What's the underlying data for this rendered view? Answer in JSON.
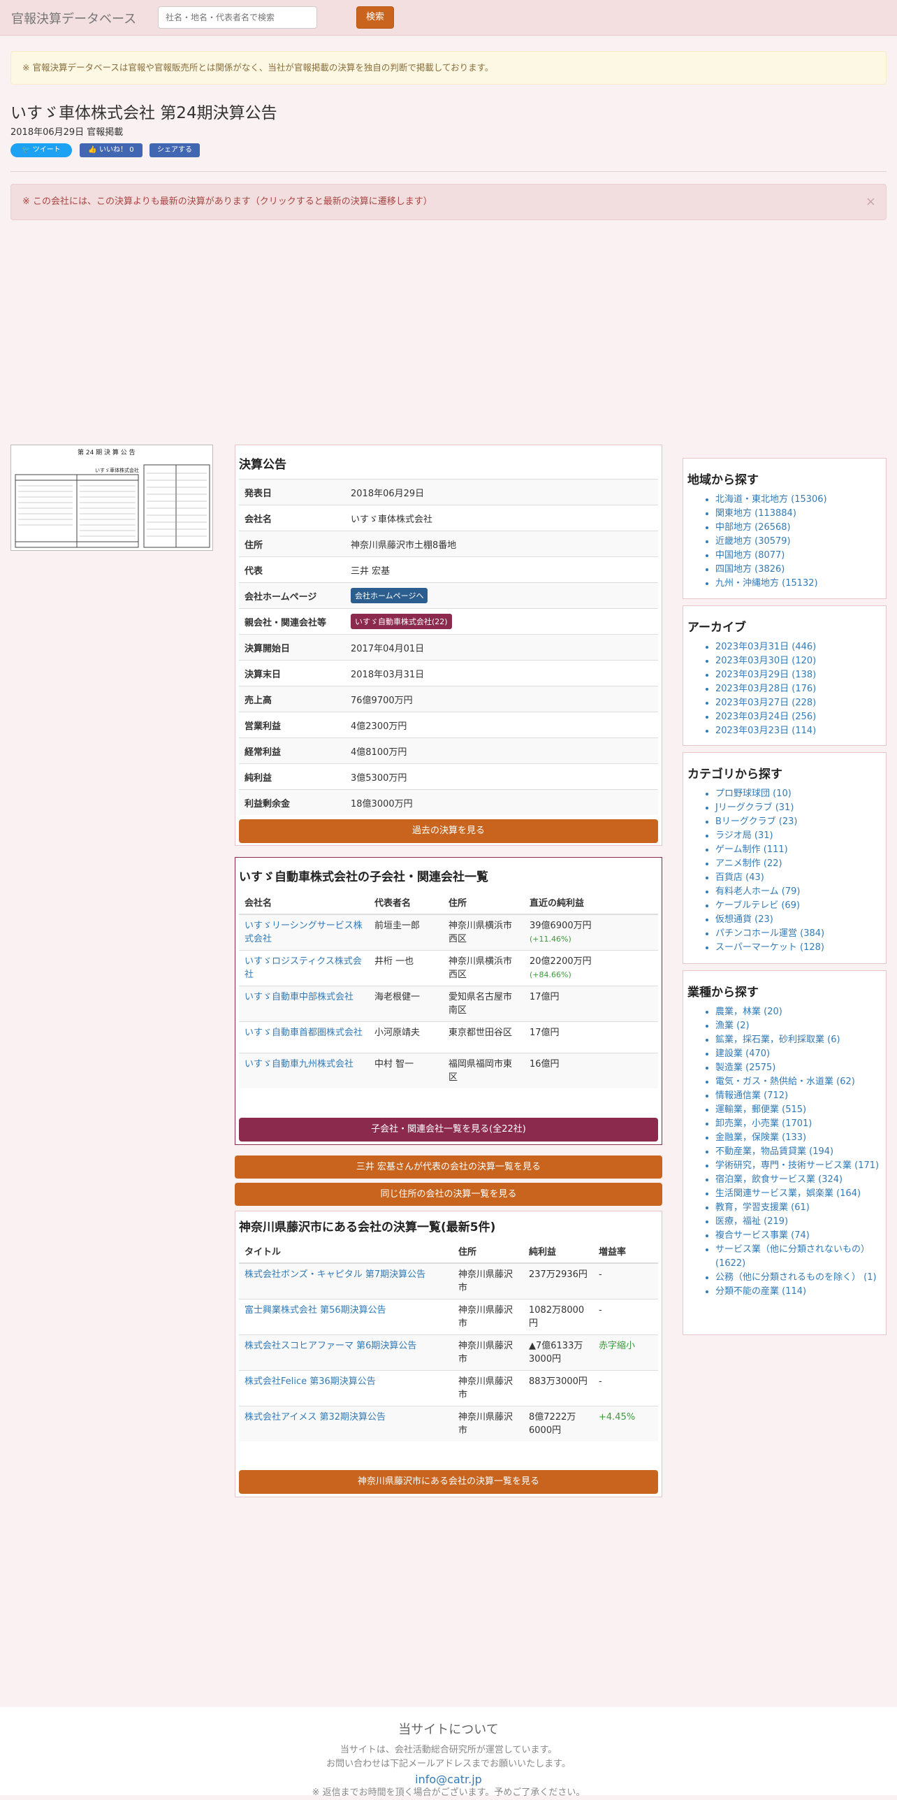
{
  "navbar": {
    "brand": "官報決算データベース",
    "search_placeholder": "社名・地名・代表者名で検索",
    "search_button": "検索"
  },
  "notice": "※ 官報決算データベースは官報や官報販売所とは関係がなく、当社が官報掲載の決算を独自の判断で掲載しております。",
  "page": {
    "title": "いすゞ車体株式会社 第24期決算公告",
    "subtitle": "2018年06月29日 官報掲載"
  },
  "social": {
    "tweet": "ツイート",
    "like": "いいね！ 0",
    "share": "シェアする"
  },
  "alert": {
    "text": "※ この会社には、この決算よりも最新の決算があります（クリックすると最新の決算に遷移します）",
    "close": "×"
  },
  "kessan": {
    "heading": "決算公告",
    "rows": [
      {
        "k": "発表日",
        "v": "2018年06月29日"
      },
      {
        "k": "会社名",
        "v": "いすゞ車体株式会社"
      },
      {
        "k": "住所",
        "v": "神奈川県藤沢市土棚8番地"
      },
      {
        "k": "代表",
        "v": "三井 宏基"
      },
      {
        "k": "会社ホームページ",
        "v": "会社ホームページへ"
      },
      {
        "k": "親会社・関連会社等",
        "v": "いすゞ自動車株式会社(22)"
      },
      {
        "k": "決算開始日",
        "v": "2017年04月01日"
      },
      {
        "k": "決算末日",
        "v": "2018年03月31日"
      },
      {
        "k": "売上高",
        "v": "76億9700万円"
      },
      {
        "k": "営業利益",
        "v": "4億2300万円"
      },
      {
        "k": "経常利益",
        "v": "4億8100万円"
      },
      {
        "k": "純利益",
        "v": "3億5300万円"
      },
      {
        "k": "利益剰余金",
        "v": "18億3000万円"
      }
    ],
    "past_button": "過去の決算を見る"
  },
  "subsidiaries": {
    "heading": "いすゞ自動車株式会社の子会社・関連会社一覧",
    "cols": [
      "会社名",
      "代表者名",
      "住所",
      "直近の純利益"
    ],
    "rows": [
      {
        "name": "いすゞリーシングサービス株式会社",
        "rep": "前垣圭一郎",
        "addr": "神奈川県横浜市西区",
        "profit": "39億6900万円",
        "pct": "(+11.46%)"
      },
      {
        "name": "いすゞロジスティクス株式会社",
        "rep": "井桁 一也",
        "addr": "神奈川県横浜市西区",
        "profit": "20億2200万円",
        "pct": "(+84.66%)"
      },
      {
        "name": "いすゞ自動車中部株式会社",
        "rep": "海老根健一",
        "addr": "愛知県名古屋市南区",
        "profit": "17億円",
        "pct": ""
      },
      {
        "name": "いすゞ自動車首都圏株式会社",
        "rep": "小河原靖夫",
        "addr": "東京都世田谷区",
        "profit": "17億円",
        "pct": ""
      },
      {
        "name": "いすゞ自動車九州株式会社",
        "rep": "中村 智一",
        "addr": "福岡県福岡市東区",
        "profit": "16億円",
        "pct": ""
      }
    ],
    "all_button": "子会社・関連会社一覧を見る(全22社)"
  },
  "rep_button": "三井 宏基さんが代表の会社の決算一覧を見る",
  "addr_button": "同じ住所の会社の決算一覧を見る",
  "area": {
    "heading": "神奈川県藤沢市にある会社の決算一覧(最新5件)",
    "cols": [
      "タイトル",
      "住所",
      "純利益",
      "増益率"
    ],
    "rows": [
      {
        "title": "株式会社ボンズ・キャピタル 第7期決算公告",
        "addr": "神奈川県藤沢市",
        "profit": "237万2936円",
        "rate": "-"
      },
      {
        "title": "富士興業株式会社 第56期決算公告",
        "addr": "神奈川県藤沢市",
        "profit": "1082万8000円",
        "rate": "-"
      },
      {
        "title": "株式会社スコヒアファーマ 第6期決算公告",
        "addr": "神奈川県藤沢市",
        "profit": "▲7億6133万3000円",
        "rate": "赤字縮小"
      },
      {
        "title": "株式会社Felice 第36期決算公告",
        "addr": "神奈川県藤沢市",
        "profit": "883万3000円",
        "rate": "-"
      },
      {
        "title": "株式会社アイメス 第32期決算公告",
        "addr": "神奈川県藤沢市",
        "profit": "8億7222万6000円",
        "rate": "+4.45%"
      }
    ],
    "more_button": "神奈川県藤沢市にある会社の決算一覧を見る"
  },
  "sidebar": {
    "region": {
      "heading": "地域から探す",
      "items": [
        "北海道・東北地方 (15306)",
        "関東地方 (113884)",
        "中部地方 (26568)",
        "近畿地方 (30579)",
        "中国地方 (8077)",
        "四国地方 (3826)",
        "九州・沖縄地方 (15132)"
      ]
    },
    "archive": {
      "heading": "アーカイブ",
      "items": [
        "2023年03月31日 (446)",
        "2023年03月30日 (120)",
        "2023年03月29日 (138)",
        "2023年03月28日 (176)",
        "2023年03月27日 (228)",
        "2023年03月24日 (256)",
        "2023年03月23日 (114)"
      ]
    },
    "category": {
      "heading": "カテゴリから探す",
      "items": [
        "プロ野球球団 (10)",
        "Jリーグクラブ (31)",
        "Bリーグクラブ (23)",
        "ラジオ局 (31)",
        "ゲーム制作 (111)",
        "アニメ制作 (22)",
        "百貨店 (43)",
        "有料老人ホーム (79)",
        "ケーブルテレビ (69)",
        "仮想通貨 (23)",
        "パチンコホール運営 (384)",
        "スーパーマーケット (128)"
      ]
    },
    "industry": {
      "heading": "業種から探す",
      "items": [
        "農業，林業 (20)",
        "漁業 (2)",
        "鉱業，採石業，砂利採取業 (6)",
        "建設業 (470)",
        "製造業 (2575)",
        "電気・ガス・熱供給・水道業 (62)",
        "情報通信業 (712)",
        "運輸業，郵便業 (515)",
        "卸売業，小売業 (1701)",
        "金融業，保険業 (133)",
        "不動産業，物品賃貸業 (194)",
        "学術研究，専門・技術サービス業 (171)",
        "宿泊業，飲食サービス業 (324)",
        "生活関連サービス業，娯楽業 (164)",
        "教育，学習支援業 (61)",
        "医療，福祉 (219)",
        "複合サービス事業 (74)",
        "サービス業（他に分類されないもの） (1622)",
        "公務（他に分類されるものを除く） (1)",
        "分類不能の産業 (114)"
      ]
    }
  },
  "footer": {
    "heading": "当サイトについて",
    "line1": "当サイトは、会社活動総合研究所が運営しています。",
    "line2": "お問い合わせは下記メールアドレスまでお願いいたします。",
    "email": "info@catr.jp",
    "line3": "※ 返信までお時間を頂く場合がございます。予めご了承ください。"
  },
  "thumb": {
    "heading": "第 24 期 決 算 公 告",
    "company": "いすゞ車体株式会社"
  }
}
